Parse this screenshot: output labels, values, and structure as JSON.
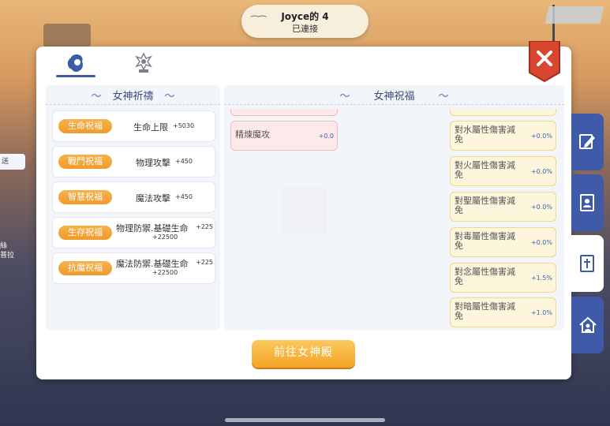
{
  "notification": {
    "title": "Joyce的 4",
    "status": "已連接"
  },
  "background": {
    "left_tab_text": "送",
    "left_label_lines": [
      "絲",
      "普拉"
    ]
  },
  "tabs": [
    {
      "icon": "goddess-portrait-icon",
      "active": true
    },
    {
      "icon": "goddess-statue-icon",
      "active": false
    }
  ],
  "left_section": {
    "title": "女神祈禱",
    "blessings": [
      {
        "tag": "生命祝福",
        "name": "生命上限",
        "value": "+5030",
        "extra": ""
      },
      {
        "tag": "戰鬥祝福",
        "name": "物理攻擊",
        "value": "+450",
        "extra": ""
      },
      {
        "tag": "智慧祝福",
        "name": "魔法攻擊",
        "value": "+450",
        "extra": ""
      },
      {
        "tag": "生存祝福",
        "name": "物理防禦.基礎生命",
        "value": "+225",
        "extra": "+22500"
      },
      {
        "tag": "抗魔祝福",
        "name": "魔法防禦.基礎生命",
        "value": "+225",
        "extra": "+22500"
      }
    ]
  },
  "right_section": {
    "title": "女神祝福",
    "pink_stats": [
      {
        "label": "精煉魔攻",
        "value": "+0.0"
      }
    ],
    "yellow_stats": [
      {
        "label_line1": "對水屬性傷害減",
        "label_line2": "免",
        "value": "+0.0%"
      },
      {
        "label_line1": "對火屬性傷害減",
        "label_line2": "免",
        "value": "+0.0%"
      },
      {
        "label_line1": "對聖屬性傷害減",
        "label_line2": "免",
        "value": "+0.0%"
      },
      {
        "label_line1": "對毒屬性傷害減",
        "label_line2": "免",
        "value": "+0.0%"
      },
      {
        "label_line1": "對念屬性傷害減",
        "label_line2": "免",
        "value": "+1.5%"
      },
      {
        "label_line1": "對暗屬性傷害減",
        "label_line2": "免",
        "value": "+1.0%"
      }
    ]
  },
  "go_button": {
    "label": "前往女神殿"
  },
  "side_tabs": [
    {
      "icon": "edit-icon",
      "active": false
    },
    {
      "icon": "address-book-icon",
      "active": false
    },
    {
      "icon": "cross-book-icon",
      "active": true
    },
    {
      "icon": "home-person-icon",
      "active": false
    }
  ],
  "colors": {
    "accent_blue": "#3f5aa9",
    "tag_orange": "#f09a2b",
    "close_red": "#d94630",
    "stat_yellow": "#fdf6dd",
    "stat_pink": "#fde8ea"
  }
}
